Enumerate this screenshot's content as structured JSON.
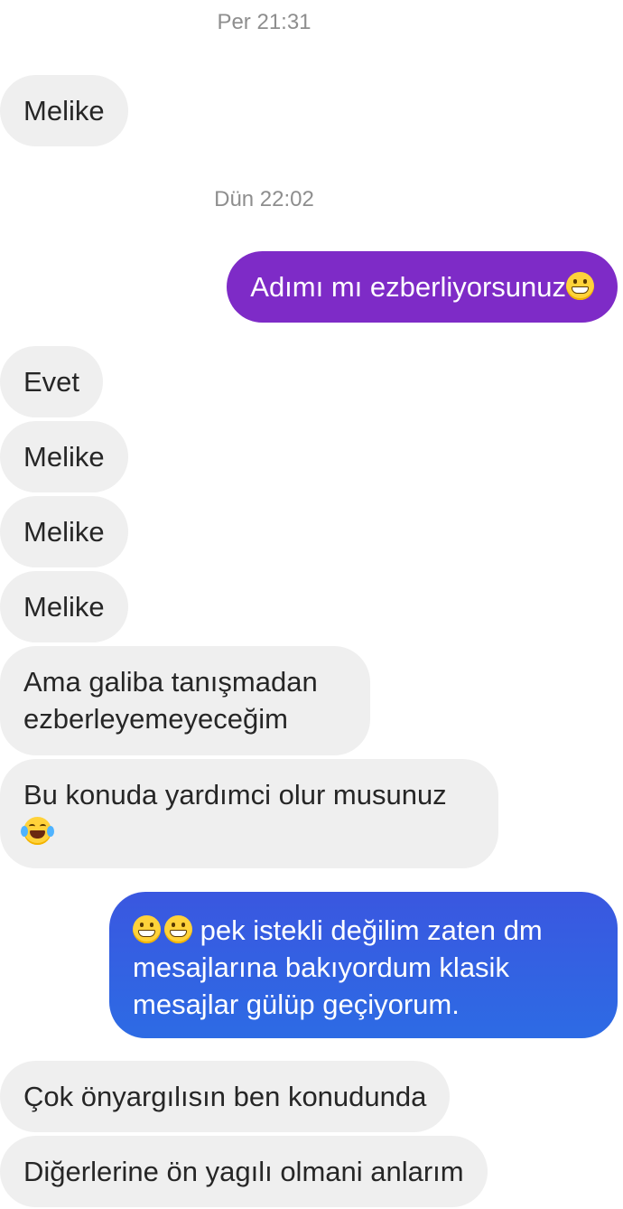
{
  "timestamps": [
    "Per 21:31",
    "Dün 22:02"
  ],
  "messages": {
    "m1": "Melike",
    "m2": "Adımı mı ezberliyorsunuz",
    "m3": "Evet",
    "m4": "Melike",
    "m5": "Melike",
    "m6": "Melike",
    "m7_line1": "Ama galiba tanışmadan",
    "m7_line2": "ezberleyemeyeceğim",
    "m8": "Bu konuda yardımci olur musunuz",
    "m9_line1": " pek istekli değilim zaten dm",
    "m9_line2": "mesajlarına bakıyordum klasik",
    "m9_line3": "mesajlar gülüp geçiyorum.",
    "m10": "Çok önyargılısın ben konudunda",
    "m11": "Diğerlerine ön yagılı olmani anlarım"
  },
  "colors": {
    "incoming": "#efefef",
    "outgoing_purple": "#7e2bc7",
    "outgoing_blue": "#2d6be4",
    "timestamp": "#8e8e8e"
  },
  "icons": [
    "grinning-emoji-icon",
    "laughing-tears-emoji-icon"
  ]
}
